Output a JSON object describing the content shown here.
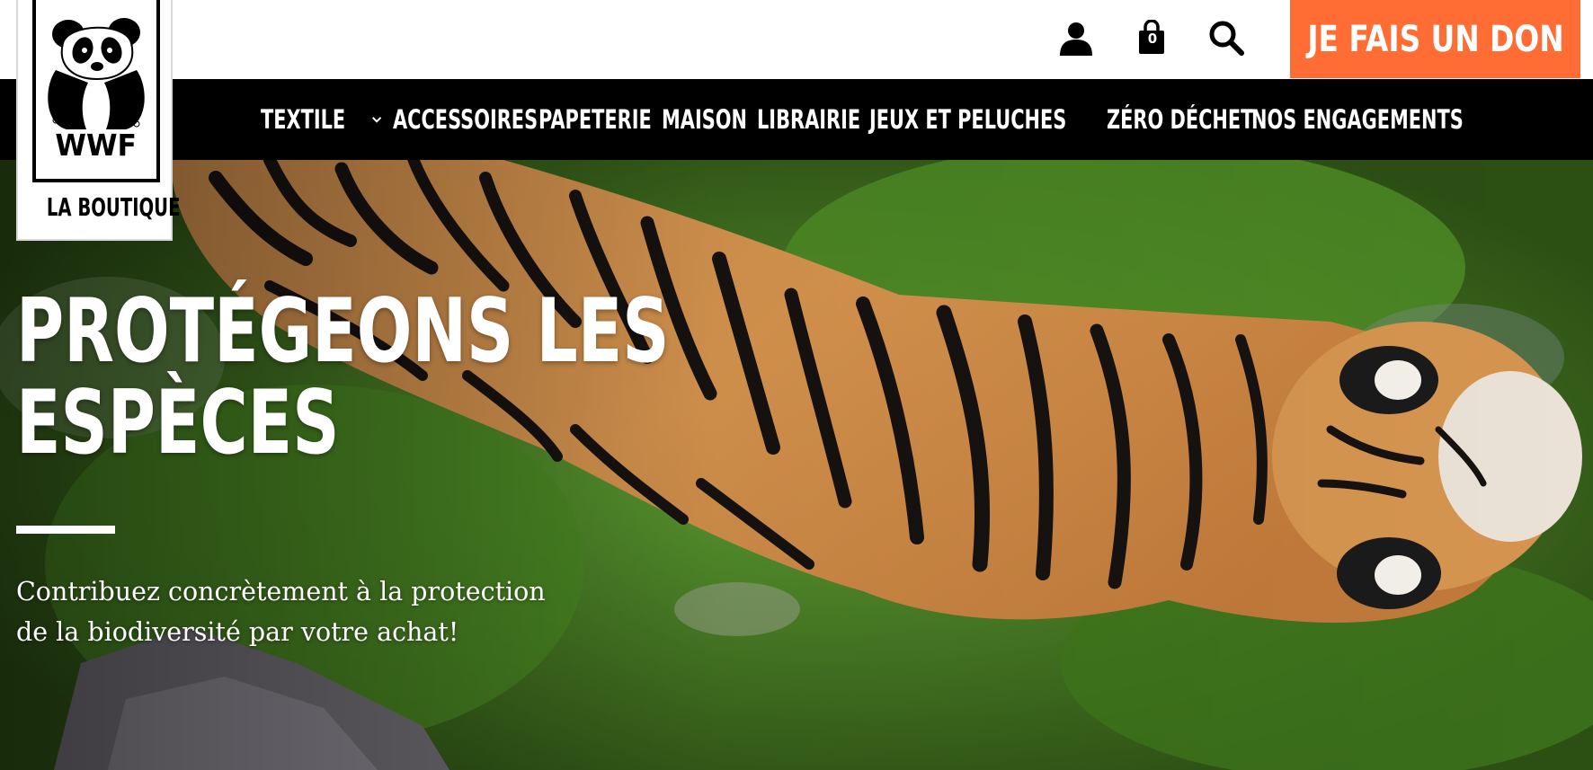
{
  "brand": {
    "logo_text": "WWF",
    "caption": "LA BOUTIQUE"
  },
  "header": {
    "icons": [
      "account-icon",
      "cart-icon",
      "search-icon"
    ],
    "cart_count": "0",
    "donate_label": "JE FAIS UN DON"
  },
  "nav": {
    "items": [
      {
        "label": "TEXTILE",
        "has_dropdown": true
      },
      {
        "label": "ACCESSOIRES",
        "has_dropdown": false
      },
      {
        "label": "PAPETERIE",
        "has_dropdown": false
      },
      {
        "label": "MAISON",
        "has_dropdown": false
      },
      {
        "label": "LIBRAIRIE",
        "has_dropdown": false
      },
      {
        "label": "JEUX ET PELUCHES",
        "has_dropdown": true
      },
      {
        "label": "ZÉRO DÉCHET",
        "has_dropdown": false
      },
      {
        "label": "NOS ENGAGEMENTS",
        "has_dropdown": true
      }
    ]
  },
  "hero": {
    "title_line1": "PROTÉGEONS LES",
    "title_line2": "ESPÈCES",
    "subtitle_line1": "Contribuez concrètement à la protection",
    "subtitle_line2": "de la biodiversité par votre achat!"
  },
  "colors": {
    "accent": "#ff6d35",
    "nav_background": "#000000",
    "text_on_dark": "#ffffff"
  }
}
